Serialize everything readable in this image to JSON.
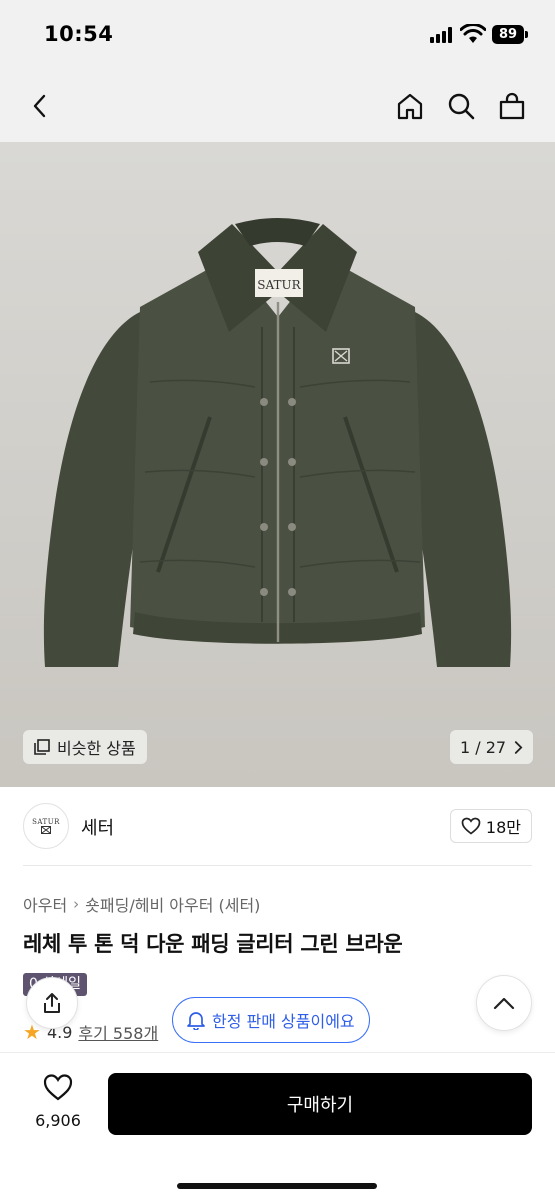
{
  "status_bar": {
    "time": "10:54",
    "battery": "89"
  },
  "nav": {
    "back_icon": "chevron-left-icon",
    "home_icon": "home-icon",
    "search_icon": "search-icon",
    "cart_icon": "shopping-bag-icon"
  },
  "hero": {
    "similar_label": "비슷한 상품",
    "counter": "1 / 27",
    "label_text": "SATUR"
  },
  "brand": {
    "logo_text": "SATUR",
    "name": "세터",
    "likes": "18만"
  },
  "breadcrumb": [
    "아우터",
    "숏패딩/헤비 아우터 (세터)"
  ],
  "product": {
    "title": "레체 투 톤 덕 다운 패딩 글리터 그린 브라운",
    "sale_badge": "0 상세일",
    "rating": "4.9",
    "reviews": "후기 558개"
  },
  "floating": {
    "limited_label": "한정 판매 상품이에요"
  },
  "bottom": {
    "wish_count": "6,906",
    "buy_label": "구매하기"
  },
  "colors": {
    "accent_blue": "#2f5ee8",
    "badge_purple": "#5e5470",
    "jacket": "#4a5142"
  }
}
